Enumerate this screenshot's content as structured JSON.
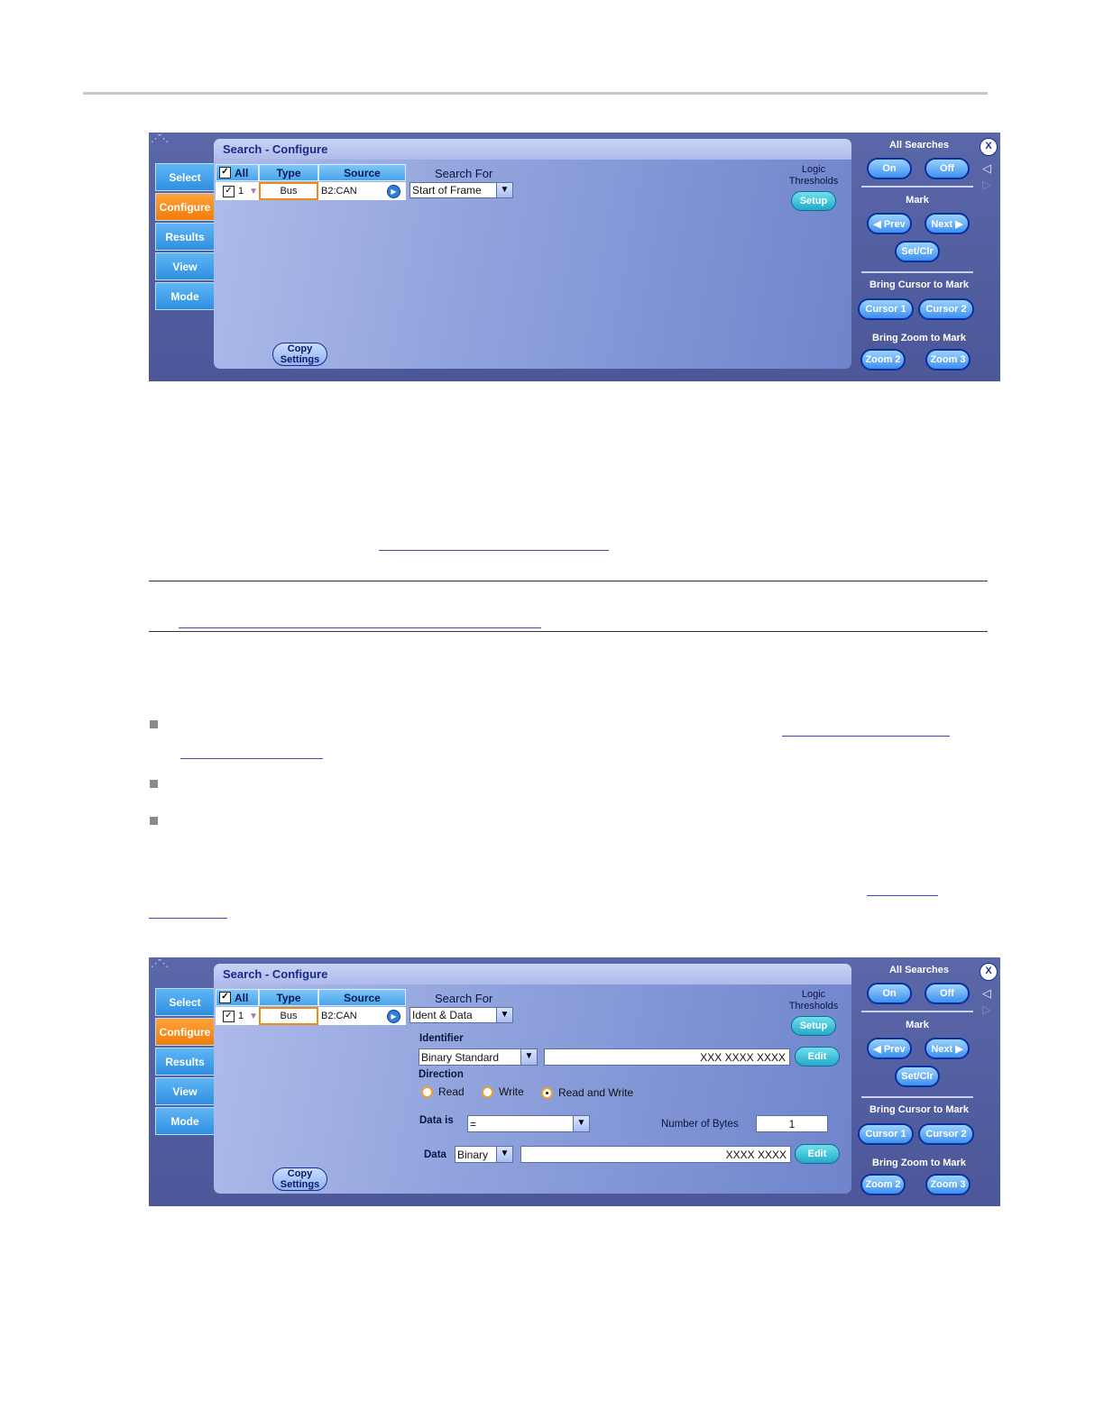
{
  "panel": {
    "title": "Search - Configure",
    "tabs": [
      "Select",
      "Configure",
      "Results",
      "View",
      "Mode"
    ],
    "grid": {
      "all_label": "All",
      "type_header": "Type",
      "source_header": "Source",
      "row_index": "1",
      "type_value": "Bus",
      "source_value": "B2:CAN"
    },
    "search_for_label": "Search For",
    "logic_thresholds_label": "Logic Thresholds",
    "setup_button": "Setup",
    "copy_settings_button": [
      "Copy",
      "Settings"
    ],
    "side": {
      "all_searches_label": "All Searches",
      "on_button": "On",
      "off_button": "Off",
      "close_button": "X",
      "mark_label": "Mark",
      "prev_button": "◀ Prev",
      "next_button": "Next ▶",
      "setclr_button": "Set/Clr",
      "bring_cursor_label": "Bring Cursor to Mark",
      "cursor1_button": "Cursor 1",
      "cursor2_button": "Cursor 2",
      "bring_zoom_label": "Bring Zoom to Mark",
      "zoom2_button": "Zoom 2",
      "zoom3_button": "Zoom 3"
    }
  },
  "panel1": {
    "search_for_value": "Start of Frame"
  },
  "panel2": {
    "search_for_value": "Ident & Data",
    "identifier_label": "Identifier",
    "identifier_format": "Binary Standard",
    "identifier_value": "XXX XXXX XXXX",
    "edit_button": "Edit",
    "direction_label": "Direction",
    "direction_options": [
      "Read",
      "Write",
      "Read and Write"
    ],
    "direction_selected": "Read and Write",
    "data_is_label": "Data is",
    "data_is_value": "=",
    "number_of_bytes_label": "Number of Bytes",
    "number_of_bytes_value": "1",
    "data_label": "Data",
    "data_format": "Binary",
    "data_value": "XXXX XXXX"
  }
}
